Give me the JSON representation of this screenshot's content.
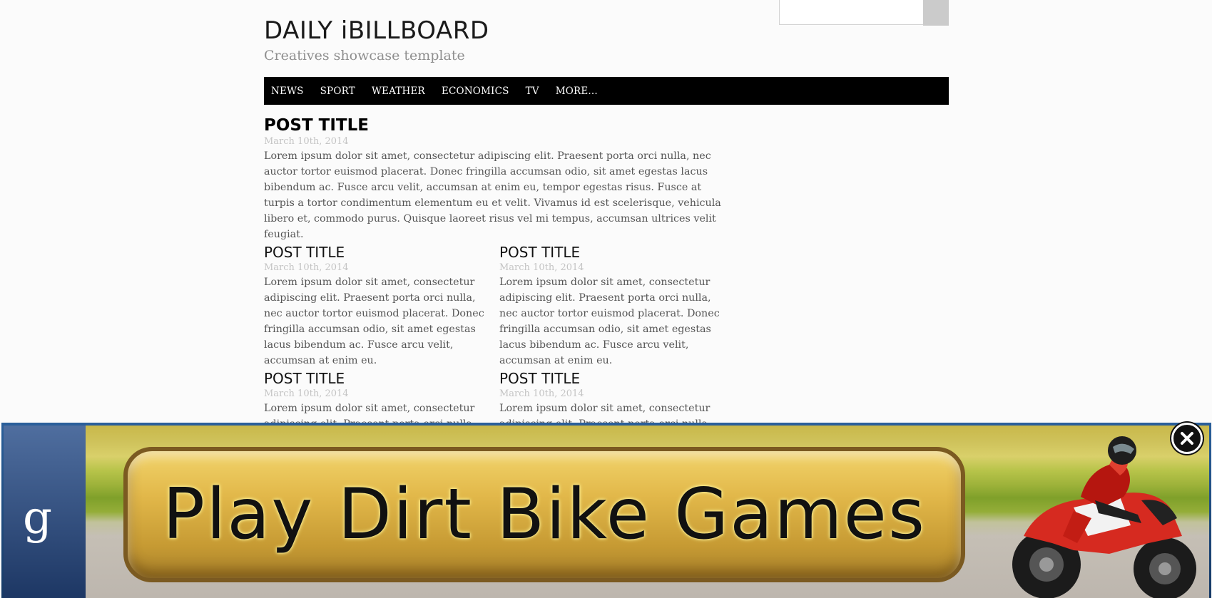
{
  "header": {
    "site_title": "DAILY iBILLBOARD",
    "tagline": "Creatives showcase template",
    "search_placeholder": ""
  },
  "nav": {
    "items": [
      "NEWS",
      "SPORT",
      "WEATHER",
      "ECONOMICS",
      "TV",
      "MORE..."
    ]
  },
  "featured_post": {
    "title": "POST TITLE",
    "date": "March 10th, 2014",
    "body": "Lorem ipsum dolor sit amet, consectetur adipiscing elit. Praesent porta orci nulla, nec auctor tortor euismod placerat. Donec fringilla accumsan odio, sit amet egestas lacus bibendum ac. Fusce arcu velit, accumsan at enim eu, tempor egestas risus. Fusce at turpis a tortor condimentum elementum eu et velit. Vivamus id est scelerisque, vehicula libero et, commodo purus. Quisque laoreet risus vel mi tempus, accumsan ultrices velit feugiat."
  },
  "posts": [
    {
      "title": "POST TITLE",
      "date": "March 10th, 2014",
      "body": "Lorem ipsum dolor sit amet, consectetur adipiscing elit. Praesent porta orci nulla, nec auctor tortor euismod placerat. Donec fringilla accumsan odio, sit amet egestas lacus bibendum ac. Fusce arcu velit, accumsan at enim eu."
    },
    {
      "title": "POST TITLE",
      "date": "March 10th, 2014",
      "body": "Lorem ipsum dolor sit amet, consectetur adipiscing elit. Praesent porta orci nulla, nec auctor tortor euismod placerat. Donec fringilla accumsan odio, sit amet egestas lacus bibendum ac. Fusce arcu velit, accumsan at enim eu."
    },
    {
      "title": "POST TITLE",
      "date": "March 10th, 2014",
      "body": "Lorem ipsum dolor sit amet, consectetur adipiscing elit. Praesent porta orci nulla, nec auctor tortor euismod placerat."
    },
    {
      "title": "POST TITLE",
      "date": "March 10th, 2014",
      "body": "Lorem ipsum dolor sit amet, consectetur adipiscing elit. Praesent porta orci nulla, nec auctor tortor euismod placerat."
    }
  ],
  "ad": {
    "logo_letter": "g",
    "headline": "Play Dirt Bike Games",
    "close_icon": "close-icon",
    "accent_color": "#e2b84a",
    "frame_color": "#1d3764"
  }
}
